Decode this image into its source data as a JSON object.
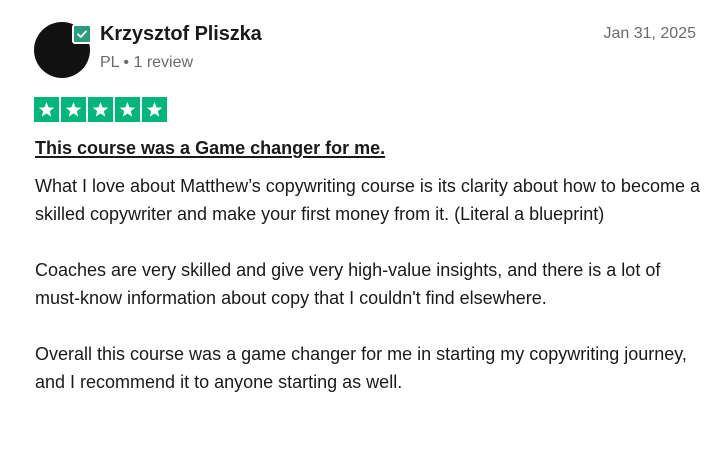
{
  "reviewer": {
    "name": "Krzysztof Pliszka",
    "meta": "PL • 1 review",
    "avatar_icon": "avatar",
    "verified_icon": "verified-check-icon"
  },
  "review": {
    "date": "Jan 31, 2025",
    "rating": 5,
    "rating_max": 5,
    "star_color": "#00b67a",
    "title": "This course was a Game changer for me.",
    "paragraphs": [
      "What I love about Matthew’s copywriting course is its clarity about how to become a skilled copywriter and make your first money from it. (Literal a blueprint)",
      "Coaches are very skilled and give very high-value insights, and there is a lot of must-know information about copy that I couldn't find elsewhere.",
      "Overall this course was a game changer for me in starting my copywriting journey, and I recommend it to anyone starting as well."
    ]
  }
}
